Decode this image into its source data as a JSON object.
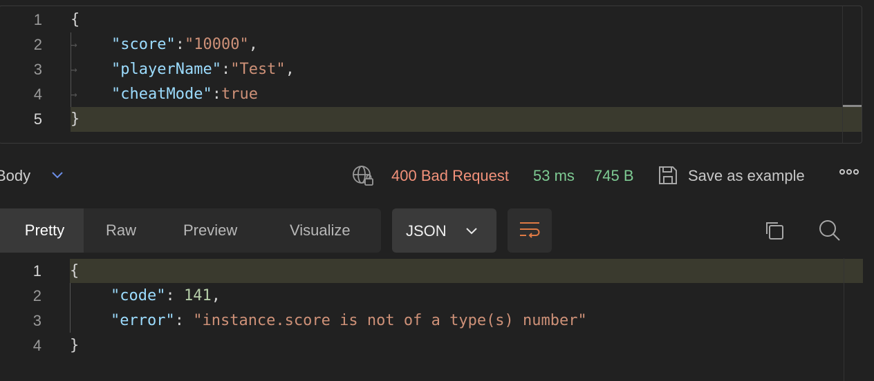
{
  "request_body": {
    "lines": [
      {
        "num": "1",
        "text": "{"
      },
      {
        "num": "2",
        "key": "\"score\"",
        "sep": ":",
        "value": "\"10000\"",
        "end": ","
      },
      {
        "num": "3",
        "key": "\"playerName\"",
        "sep": ":",
        "value": "\"Test\"",
        "end": ","
      },
      {
        "num": "4",
        "key": "\"cheatMode\"",
        "sep": ":",
        "value": "true",
        "end": ""
      },
      {
        "num": "5",
        "text": "}"
      }
    ]
  },
  "response_bar": {
    "section_label": "Body",
    "status": "400 Bad Request",
    "time": "53 ms",
    "size": "745 B",
    "save_label": "Save as example",
    "status_color": "#f2917a",
    "metric_color": "#7ecb93"
  },
  "view_tabs": [
    "Pretty",
    "Raw",
    "Preview",
    "Visualize"
  ],
  "format": "JSON",
  "icons": {
    "chevron": "chevron-down-icon",
    "globe": "globe-lock-icon",
    "save": "save-icon",
    "more": "more-horizontal-icon",
    "wrap": "wrap-lines-icon",
    "copy": "copy-icon",
    "search": "search-icon"
  },
  "response_body": {
    "lines": [
      {
        "num": "1",
        "text": "{"
      },
      {
        "num": "2",
        "key": "\"code\"",
        "sep": ": ",
        "value": "141",
        "end": ","
      },
      {
        "num": "3",
        "key": "\"error\"",
        "sep": ": ",
        "value": "\"instance.score is not of a type(s) number\"",
        "end": ""
      },
      {
        "num": "4",
        "text": "}"
      }
    ]
  }
}
